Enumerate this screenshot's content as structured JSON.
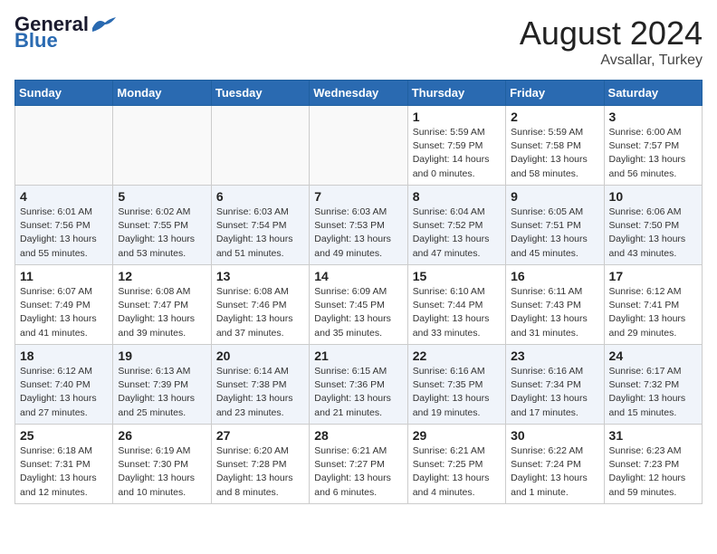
{
  "header": {
    "logo_text_general": "General",
    "logo_text_blue": "Blue",
    "month_title": "August 2024",
    "location": "Avsallar, Turkey"
  },
  "weekdays": [
    "Sunday",
    "Monday",
    "Tuesday",
    "Wednesday",
    "Thursday",
    "Friday",
    "Saturday"
  ],
  "weeks": [
    [
      {
        "day": "",
        "info": ""
      },
      {
        "day": "",
        "info": ""
      },
      {
        "day": "",
        "info": ""
      },
      {
        "day": "",
        "info": ""
      },
      {
        "day": "1",
        "sunrise": "Sunrise: 5:59 AM",
        "sunset": "Sunset: 7:59 PM",
        "daylight": "Daylight: 14 hours and 0 minutes."
      },
      {
        "day": "2",
        "sunrise": "Sunrise: 5:59 AM",
        "sunset": "Sunset: 7:58 PM",
        "daylight": "Daylight: 13 hours and 58 minutes."
      },
      {
        "day": "3",
        "sunrise": "Sunrise: 6:00 AM",
        "sunset": "Sunset: 7:57 PM",
        "daylight": "Daylight: 13 hours and 56 minutes."
      }
    ],
    [
      {
        "day": "4",
        "sunrise": "Sunrise: 6:01 AM",
        "sunset": "Sunset: 7:56 PM",
        "daylight": "Daylight: 13 hours and 55 minutes."
      },
      {
        "day": "5",
        "sunrise": "Sunrise: 6:02 AM",
        "sunset": "Sunset: 7:55 PM",
        "daylight": "Daylight: 13 hours and 53 minutes."
      },
      {
        "day": "6",
        "sunrise": "Sunrise: 6:03 AM",
        "sunset": "Sunset: 7:54 PM",
        "daylight": "Daylight: 13 hours and 51 minutes."
      },
      {
        "day": "7",
        "sunrise": "Sunrise: 6:03 AM",
        "sunset": "Sunset: 7:53 PM",
        "daylight": "Daylight: 13 hours and 49 minutes."
      },
      {
        "day": "8",
        "sunrise": "Sunrise: 6:04 AM",
        "sunset": "Sunset: 7:52 PM",
        "daylight": "Daylight: 13 hours and 47 minutes."
      },
      {
        "day": "9",
        "sunrise": "Sunrise: 6:05 AM",
        "sunset": "Sunset: 7:51 PM",
        "daylight": "Daylight: 13 hours and 45 minutes."
      },
      {
        "day": "10",
        "sunrise": "Sunrise: 6:06 AM",
        "sunset": "Sunset: 7:50 PM",
        "daylight": "Daylight: 13 hours and 43 minutes."
      }
    ],
    [
      {
        "day": "11",
        "sunrise": "Sunrise: 6:07 AM",
        "sunset": "Sunset: 7:49 PM",
        "daylight": "Daylight: 13 hours and 41 minutes."
      },
      {
        "day": "12",
        "sunrise": "Sunrise: 6:08 AM",
        "sunset": "Sunset: 7:47 PM",
        "daylight": "Daylight: 13 hours and 39 minutes."
      },
      {
        "day": "13",
        "sunrise": "Sunrise: 6:08 AM",
        "sunset": "Sunset: 7:46 PM",
        "daylight": "Daylight: 13 hours and 37 minutes."
      },
      {
        "day": "14",
        "sunrise": "Sunrise: 6:09 AM",
        "sunset": "Sunset: 7:45 PM",
        "daylight": "Daylight: 13 hours and 35 minutes."
      },
      {
        "day": "15",
        "sunrise": "Sunrise: 6:10 AM",
        "sunset": "Sunset: 7:44 PM",
        "daylight": "Daylight: 13 hours and 33 minutes."
      },
      {
        "day": "16",
        "sunrise": "Sunrise: 6:11 AM",
        "sunset": "Sunset: 7:43 PM",
        "daylight": "Daylight: 13 hours and 31 minutes."
      },
      {
        "day": "17",
        "sunrise": "Sunrise: 6:12 AM",
        "sunset": "Sunset: 7:41 PM",
        "daylight": "Daylight: 13 hours and 29 minutes."
      }
    ],
    [
      {
        "day": "18",
        "sunrise": "Sunrise: 6:12 AM",
        "sunset": "Sunset: 7:40 PM",
        "daylight": "Daylight: 13 hours and 27 minutes."
      },
      {
        "day": "19",
        "sunrise": "Sunrise: 6:13 AM",
        "sunset": "Sunset: 7:39 PM",
        "daylight": "Daylight: 13 hours and 25 minutes."
      },
      {
        "day": "20",
        "sunrise": "Sunrise: 6:14 AM",
        "sunset": "Sunset: 7:38 PM",
        "daylight": "Daylight: 13 hours and 23 minutes."
      },
      {
        "day": "21",
        "sunrise": "Sunrise: 6:15 AM",
        "sunset": "Sunset: 7:36 PM",
        "daylight": "Daylight: 13 hours and 21 minutes."
      },
      {
        "day": "22",
        "sunrise": "Sunrise: 6:16 AM",
        "sunset": "Sunset: 7:35 PM",
        "daylight": "Daylight: 13 hours and 19 minutes."
      },
      {
        "day": "23",
        "sunrise": "Sunrise: 6:16 AM",
        "sunset": "Sunset: 7:34 PM",
        "daylight": "Daylight: 13 hours and 17 minutes."
      },
      {
        "day": "24",
        "sunrise": "Sunrise: 6:17 AM",
        "sunset": "Sunset: 7:32 PM",
        "daylight": "Daylight: 13 hours and 15 minutes."
      }
    ],
    [
      {
        "day": "25",
        "sunrise": "Sunrise: 6:18 AM",
        "sunset": "Sunset: 7:31 PM",
        "daylight": "Daylight: 13 hours and 12 minutes."
      },
      {
        "day": "26",
        "sunrise": "Sunrise: 6:19 AM",
        "sunset": "Sunset: 7:30 PM",
        "daylight": "Daylight: 13 hours and 10 minutes."
      },
      {
        "day": "27",
        "sunrise": "Sunrise: 6:20 AM",
        "sunset": "Sunset: 7:28 PM",
        "daylight": "Daylight: 13 hours and 8 minutes."
      },
      {
        "day": "28",
        "sunrise": "Sunrise: 6:21 AM",
        "sunset": "Sunset: 7:27 PM",
        "daylight": "Daylight: 13 hours and 6 minutes."
      },
      {
        "day": "29",
        "sunrise": "Sunrise: 6:21 AM",
        "sunset": "Sunset: 7:25 PM",
        "daylight": "Daylight: 13 hours and 4 minutes."
      },
      {
        "day": "30",
        "sunrise": "Sunrise: 6:22 AM",
        "sunset": "Sunset: 7:24 PM",
        "daylight": "Daylight: 13 hours and 1 minute."
      },
      {
        "day": "31",
        "sunrise": "Sunrise: 6:23 AM",
        "sunset": "Sunset: 7:23 PM",
        "daylight": "Daylight: 12 hours and 59 minutes."
      }
    ]
  ]
}
